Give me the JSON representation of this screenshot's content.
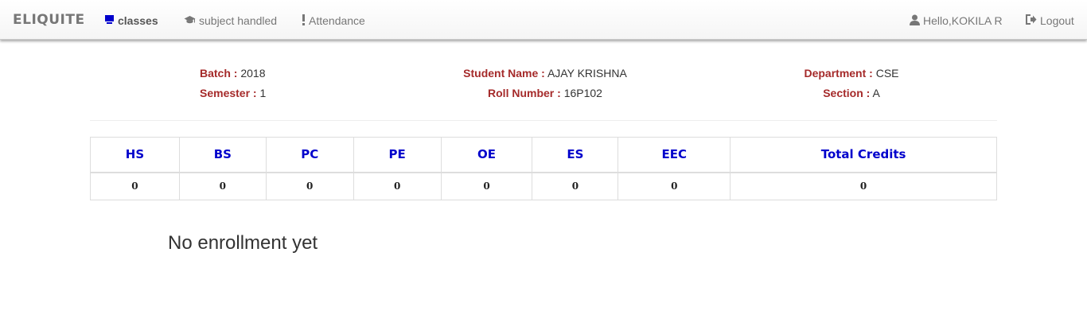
{
  "navbar": {
    "brand": "ELIQUITE",
    "items": [
      {
        "label": "classes",
        "icon": "monitor-icon"
      },
      {
        "label": "subject handled",
        "icon": "graduation-cap-icon"
      },
      {
        "label": "Attendance",
        "icon": "exclamation-icon"
      }
    ],
    "user_greeting": "Hello,KOKILA R",
    "logout_label": "Logout",
    "colors": {
      "active_icon": "#0000cc",
      "text": "#777777"
    }
  },
  "student_info": {
    "batch": {
      "label": "Batch :",
      "value": "2018"
    },
    "semester": {
      "label": "Semester :",
      "value": "1"
    },
    "student_name": {
      "label": "Student Name :",
      "value": "AJAY KRISHNA"
    },
    "roll_number": {
      "label": "Roll Number :",
      "value": "16P102"
    },
    "department": {
      "label": "Department :",
      "value": "CSE"
    },
    "section": {
      "label": "Section :",
      "value": "A"
    },
    "label_color": "#a52a2a"
  },
  "credits_table": {
    "headers": [
      "HS",
      "BS",
      "PC",
      "PE",
      "OE",
      "ES",
      "EEC",
      "Total Credits"
    ],
    "values": [
      "0",
      "0",
      "0",
      "0",
      "0",
      "0",
      "0",
      "0"
    ],
    "header_color": "#0000cc"
  },
  "enrollment_message": "No enrollment yet"
}
